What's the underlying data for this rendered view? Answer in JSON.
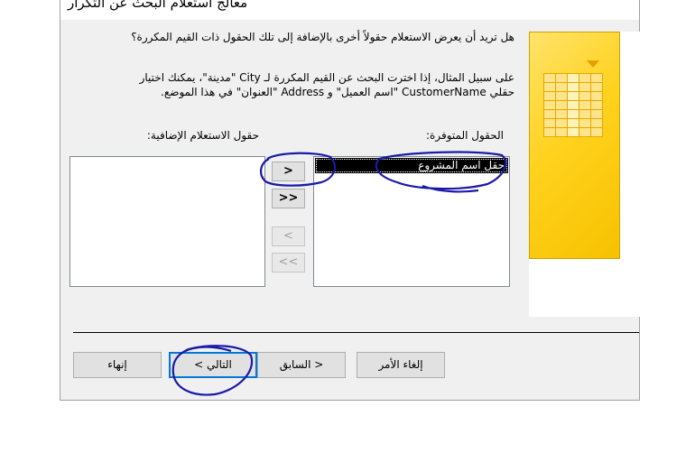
{
  "window": {
    "title": "معالج استعلام البحث عن التكرار"
  },
  "content": {
    "question": "هل تريد أن يعرض الاستعلام حقولاً أخرى بالإضافة إلى تلك الحقول ذات القيم المكررة؟",
    "example_line1": "على سبيل المثال، إذا اخترت البحث عن القيم المكررة لـ City \"مدينة\"، يمكنك اختيار",
    "example_line2": "حقلي CustomerName \"اسم العميل\" و Address \"العنوان\" في هذا الموضع.",
    "available_label": "الحقول المتوفرة:",
    "additional_label": "حقول الاستعلام الإضافية:",
    "available_fields": [
      "حقل اسم المشروع"
    ],
    "additional_fields": []
  },
  "move_buttons": {
    "add": ">",
    "add_all": ">>",
    "remove": "<",
    "remove_all": "<<"
  },
  "footer": {
    "cancel": "إلغاء الأمر",
    "back": "< السابق",
    "next": "التالي >",
    "finish": "إنهاء"
  },
  "colors": {
    "dialog_bg": "#f0f0f0",
    "illustration": "#ffd21e",
    "selection": "#000000",
    "annotation_ink": "#1a1aa8",
    "default_button_border": "#0078d7"
  }
}
